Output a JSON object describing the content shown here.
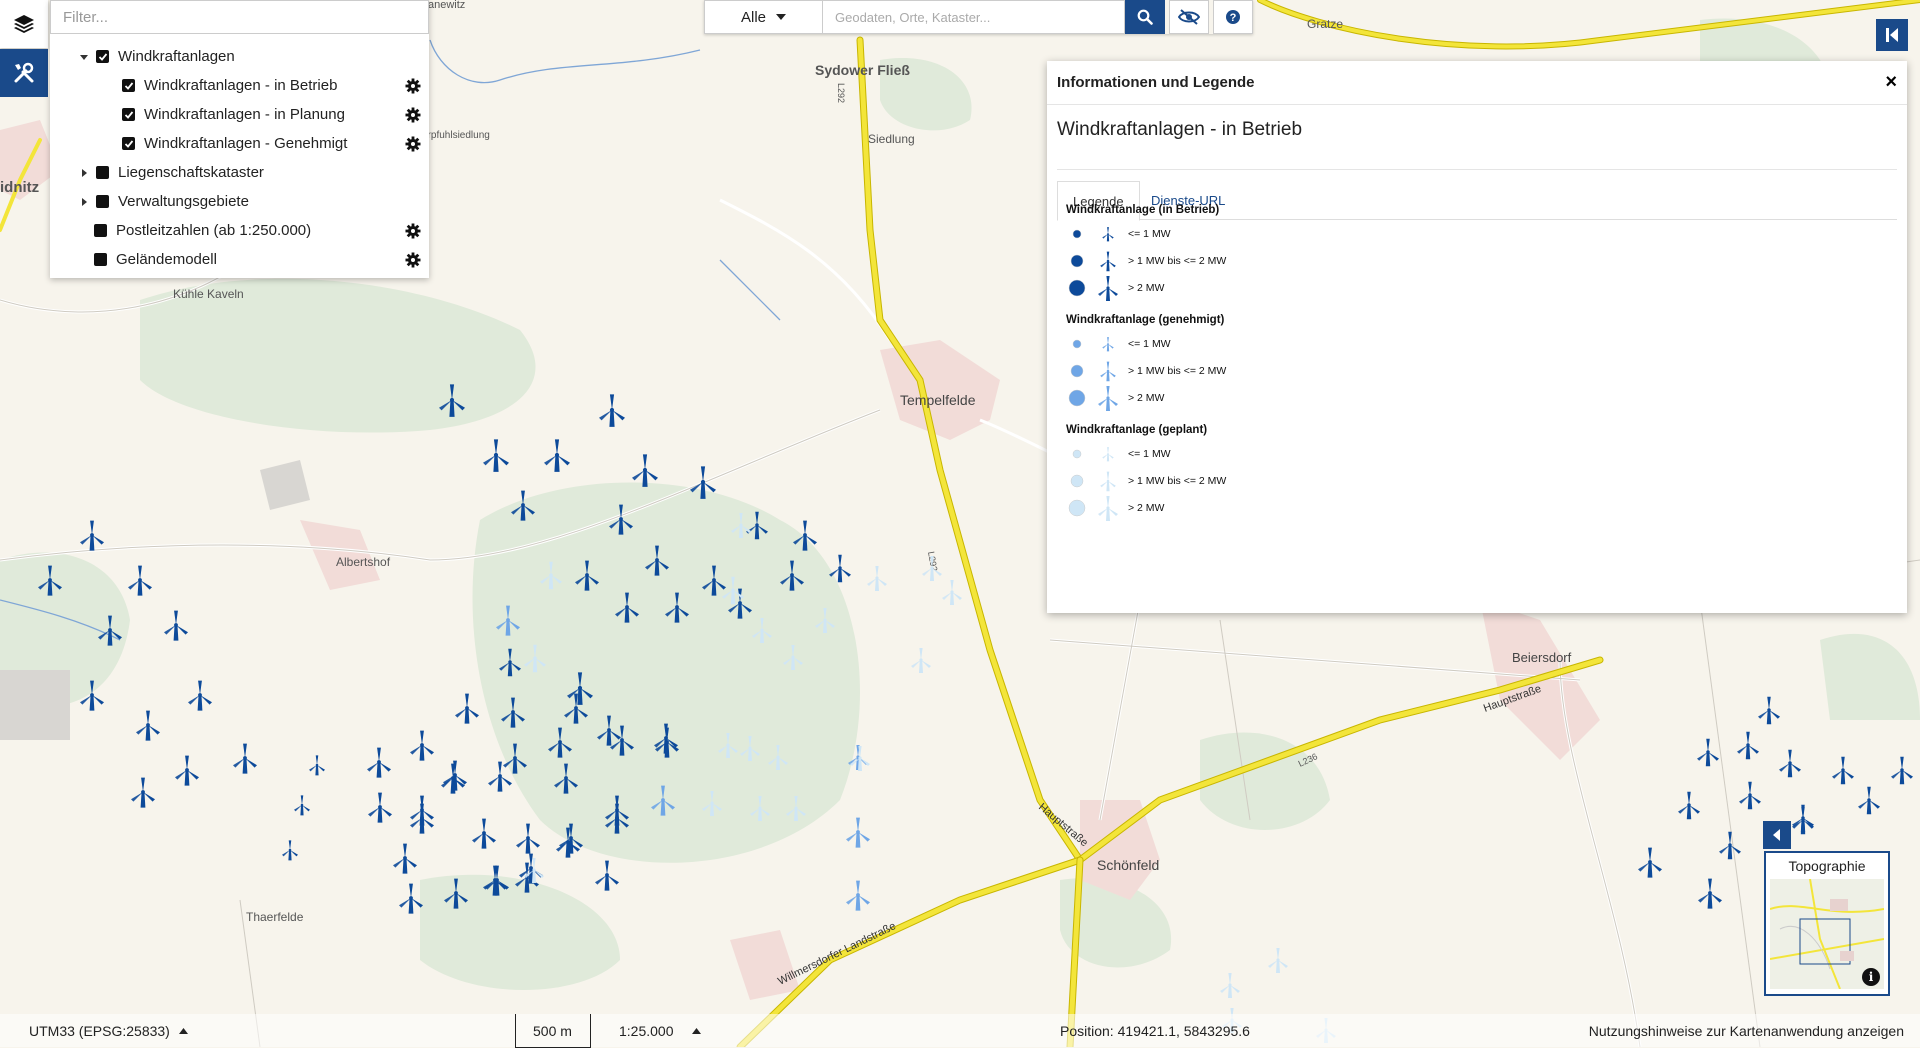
{
  "layer_panel": {
    "filter_placeholder": "Filter...",
    "rows": [
      {
        "label": "Windkraftanlagen",
        "checked": true,
        "caret": "down",
        "settings": false
      },
      {
        "label": "Windkraftanlagen - in Betrieb",
        "checked": true,
        "caret": "none",
        "settings": true
      },
      {
        "label": "Windkraftanlagen - in Planung",
        "checked": true,
        "caret": "none",
        "settings": true
      },
      {
        "label": "Windkraftanlagen - Genehmigt",
        "checked": true,
        "caret": "none",
        "settings": true
      },
      {
        "label": "Liegenschaftskataster",
        "checked": false,
        "caret": "right",
        "settings": false
      },
      {
        "label": "Verwaltungsgebiete",
        "checked": false,
        "caret": "right",
        "settings": false
      },
      {
        "label": "Postleitzahlen (ab 1:250.000)",
        "checked": false,
        "caret": "none",
        "settings": true
      },
      {
        "label": "Geländemodell",
        "checked": false,
        "caret": "none",
        "settings": true
      }
    ]
  },
  "search": {
    "category": "Alle",
    "placeholder": "Geodaten, Orte, Kataster..."
  },
  "info_panel": {
    "title": "Informationen und Legende",
    "close_glyph": "×",
    "layer_name": "Windkraftanlagen - in Betrieb",
    "tabs": [
      "Legende",
      "Dienste-URL"
    ],
    "legend_groups": [
      {
        "title": "Windkraftanlage (in Betrieb)",
        "color": "#0d4a9a",
        "items": [
          "<= 1 MW",
          "> 1 MW bis <= 2 MW",
          "> 2 MW"
        ]
      },
      {
        "title": "Windkraftanlage (genehmigt)",
        "color": "#6fa6e6",
        "items": [
          "<= 1 MW",
          "> 1 MW bis <= 2 MW",
          "> 2 MW"
        ]
      },
      {
        "title": "Windkraftanlage (geplant)",
        "color": "#cfe6f6",
        "items": [
          "<= 1 MW",
          "> 1 MW bis <= 2 MW",
          "> 2 MW"
        ]
      }
    ]
  },
  "overview": {
    "title": "Topographie",
    "info_glyph": "i"
  },
  "footer": {
    "crs": "UTM33 (EPSG:25833)",
    "scale_bar": "500 m",
    "scale": "1:25.000",
    "position": "Position: 419421.1, 5843295.6",
    "terms": "Nutzungshinweise zur Kartenanwendung anzeigen"
  },
  "map_labels": {
    "sydower": "Sydower Fließ",
    "siedlung": "Siedlung",
    "tempelfelde": "Tempelfelde",
    "albertshof": "Albertshof",
    "kuehle": "Kühle Kaveln",
    "schoenfeld": "Schönfeld",
    "beiersdorf": "Beiersdorf",
    "thaerfelde": "Thaerfelde",
    "gratze": "Gratze",
    "idnitz": "idnitz",
    "pfuhl": "erpfuhlsiedlung",
    "hauptstrasse": "Hauptstraße",
    "hauptstr2": "Hauptstraße",
    "willmersdorfer": "Willmersdorfer Landstraße",
    "l292a": "L292",
    "l292b": "L292",
    "l236": "L236",
    "anewitz": "anewitz"
  },
  "colors": {
    "accent": "#1a4a8a",
    "betrieb": "#0d4a9a",
    "genehmigt": "#6fa6e6",
    "geplant": "#cfe6f6",
    "road": "#f0e030"
  }
}
